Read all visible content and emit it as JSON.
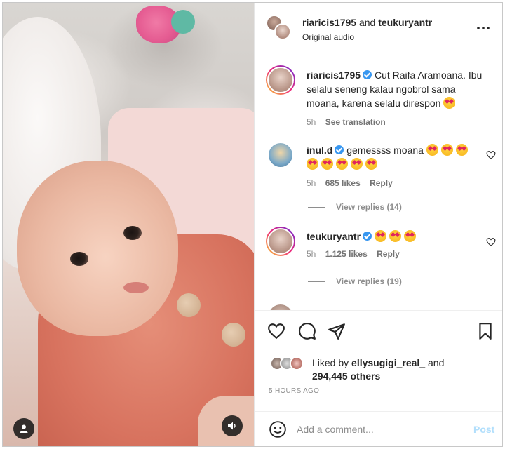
{
  "header": {
    "user1": "riaricis1795",
    "joiner": "and",
    "user2": "teukuryantr",
    "audio": "Original audio"
  },
  "caption": {
    "username": "riaricis1795",
    "text": "Cut Raifa Aramoana. Ibu selalu seneng kalau ngobrol sama moana, karena selalu direspon",
    "time": "5h",
    "see_translation": "See translation"
  },
  "comments": [
    {
      "username": "inul.d",
      "text": "gemessss moana",
      "emoji_count": 8,
      "time": "5h",
      "likes": "685 likes",
      "reply": "Reply",
      "view_replies": "View replies (14)"
    },
    {
      "username": "teukuryantr",
      "text": "",
      "emoji_count": 3,
      "time": "5h",
      "likes": "1.125 likes",
      "reply": "Reply",
      "view_replies": "View replies (19)"
    }
  ],
  "likes": {
    "prefix": "Liked by",
    "user": "ellysugigi_real_",
    "joiner": "and",
    "others": "294,445 others"
  },
  "timestamp": "5 HOURS AGO",
  "composer": {
    "placeholder": "Add a comment...",
    "post_label": "Post"
  },
  "colors": {
    "verified": "#3897f0",
    "post_disabled": "#b2dffc",
    "meta_gray": "#8e8e8e"
  },
  "icons": [
    "more-icon",
    "heart-icon",
    "comment-icon",
    "share-icon",
    "save-icon",
    "emoji-icon",
    "user-tag-icon",
    "sound-icon"
  ]
}
